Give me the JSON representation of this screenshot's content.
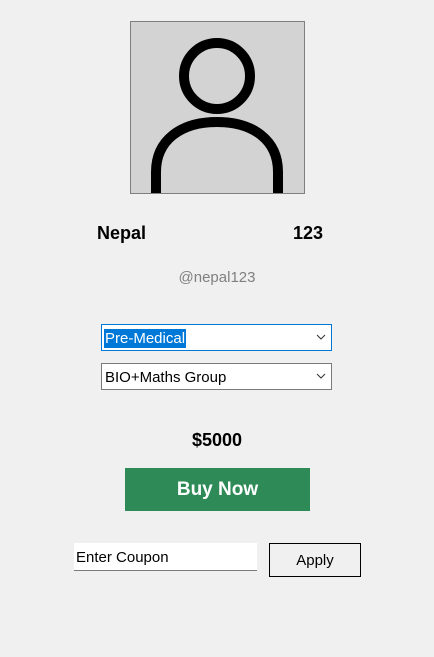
{
  "profile": {
    "first_name": "Nepal",
    "last_name": "123",
    "username": "@nepal123",
    "avatar_icon": "user-silhouette-icon"
  },
  "course_select": {
    "value": "Pre-Medical"
  },
  "group_select": {
    "value": "BIO+Maths Group"
  },
  "price": "$5000",
  "buy_button": {
    "label": "Buy Now",
    "color": "#2e8b57"
  },
  "coupon": {
    "value": "Enter Coupon"
  },
  "apply_button": {
    "label": "Apply"
  }
}
